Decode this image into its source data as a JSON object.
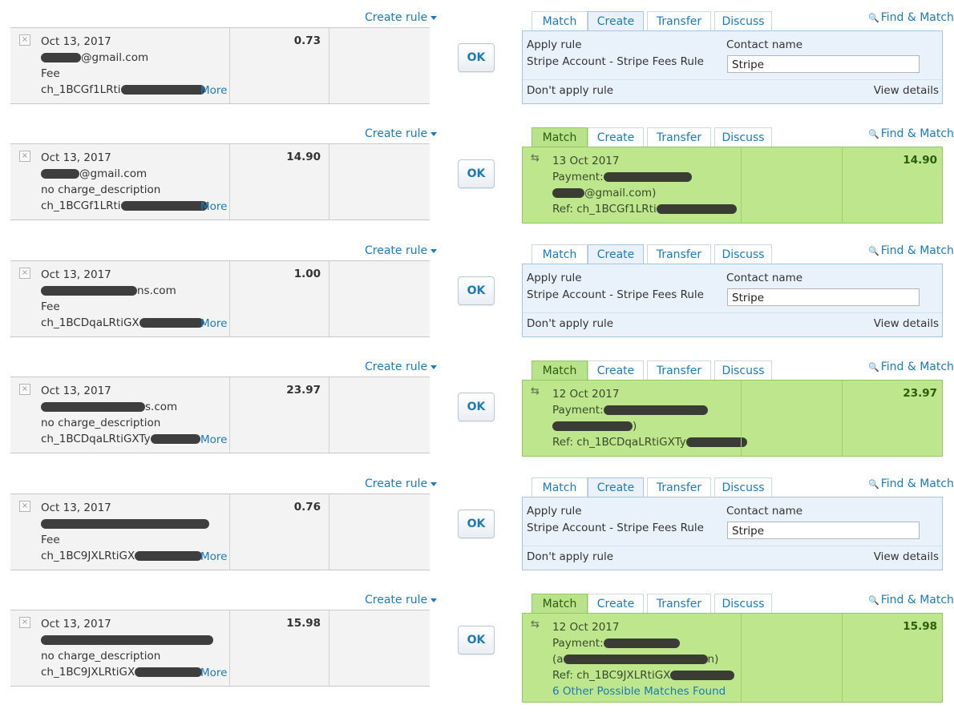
{
  "common": {
    "create_rule": "Create rule",
    "ok": "OK",
    "more": "More",
    "tabs": [
      "Match",
      "Create",
      "Transfer",
      "Discuss"
    ],
    "find_match": "Find & Match",
    "apply_rule": "Apply rule",
    "contact_name": "Contact name",
    "rule_name": "Stripe Account - Stripe Fees Rule",
    "contact_value": "Stripe",
    "dont_apply": "Don't apply rule",
    "view_details": "View details"
  },
  "rows": [
    {
      "statement": {
        "date": "Oct 13, 2017",
        "line2": "@gmail.com",
        "line3": "Fee",
        "line4": "ch_1BCGf1LRti",
        "amount": "0.73"
      },
      "active_tab": "Create"
    },
    {
      "statement": {
        "date": "Oct 13, 2017",
        "line2": "@gmail.com",
        "line3": "no charge_description",
        "line4": "ch_1BCGf1LRti",
        "amount": "14.90"
      },
      "active_tab": "Match",
      "match": {
        "date": "13 Oct 2017",
        "line2": "Payment:",
        "line3": "@gmail.com)",
        "line4": "Ref: ch_1BCGf1LRti",
        "amount": "14.90"
      }
    },
    {
      "statement": {
        "date": "Oct 13, 2017",
        "line2": "ns.com",
        "line3": "Fee",
        "line4": "ch_1BCDqaLRtiGX",
        "amount": "1.00"
      },
      "active_tab": "Create"
    },
    {
      "statement": {
        "date": "Oct 13, 2017",
        "line2": "s.com",
        "line3": "no charge_description",
        "line4": "ch_1BCDqaLRtiGXTy",
        "amount": "23.97"
      },
      "active_tab": "Match",
      "match": {
        "date": "12 Oct 2017",
        "line2": "Payment:",
        "line3": ")",
        "line4": "Ref: ch_1BCDqaLRtiGXTy",
        "amount": "23.97"
      }
    },
    {
      "statement": {
        "date": "Oct 13, 2017",
        "line2": "",
        "line3": "Fee",
        "line4": "ch_1BC9JXLRtiGX",
        "amount": "0.76"
      },
      "active_tab": "Create"
    },
    {
      "statement": {
        "date": "Oct 13, 2017",
        "line2": "",
        "line3": "no charge_description",
        "line4": "ch_1BC9JXLRtiGX",
        "amount": "15.98"
      },
      "active_tab": "Match",
      "match": {
        "date": "12 Oct 2017",
        "line2": "Payment:",
        "line3": "(a",
        "line3b": "n)",
        "line4": "Ref: ch_1BC9JXLRtiGX",
        "extra_link": "6 Other Possible Matches Found",
        "amount": "15.98"
      }
    }
  ]
}
